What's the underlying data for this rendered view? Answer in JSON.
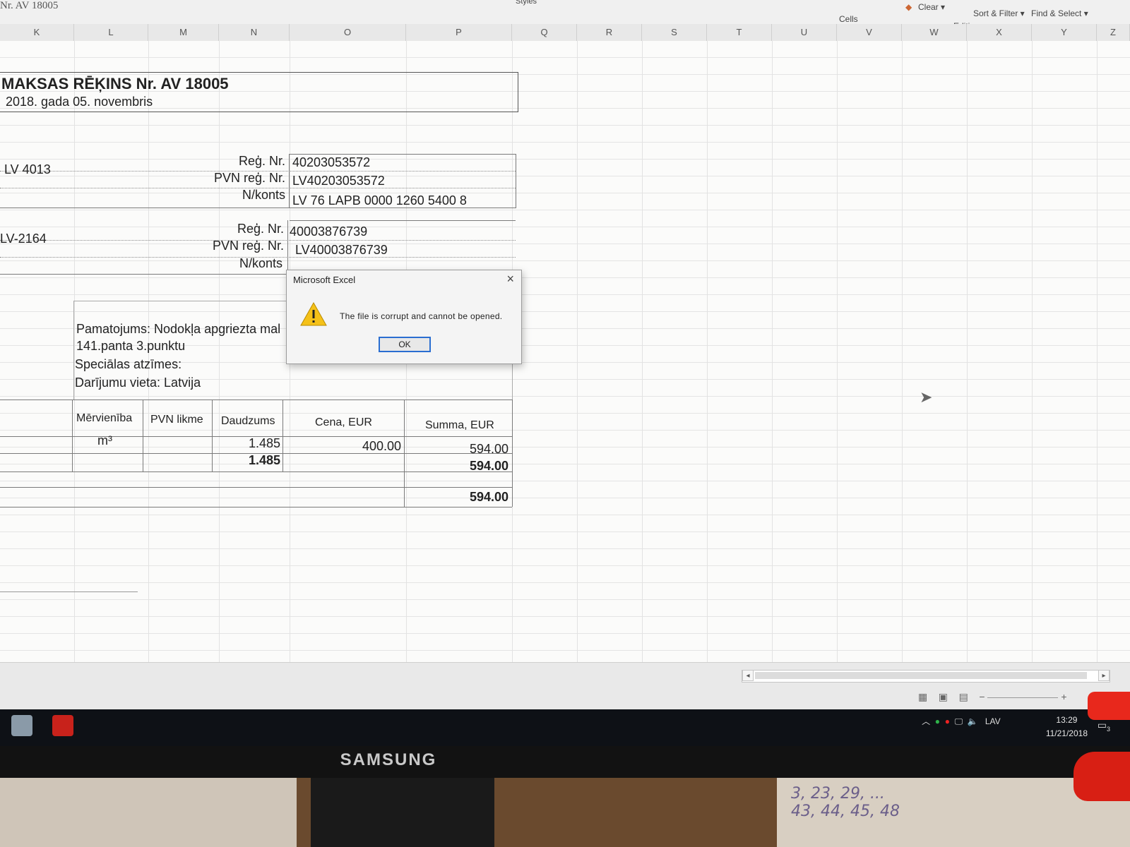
{
  "excel": {
    "namebox": "Nr. AV 18005",
    "ribbon": {
      "styles_label": "Styles",
      "cells_label": "Cells",
      "clear_label": "Clear ▾",
      "sort_filter_label": "Sort & Filter ▾",
      "find_select_label": "Find & Select ▾",
      "editing_label": "Editing"
    },
    "columns": [
      "K",
      "L",
      "M",
      "N",
      "O",
      "P",
      "Q",
      "R",
      "S",
      "T",
      "U",
      "V",
      "W",
      "X",
      "Y",
      "Z"
    ],
    "invoice": {
      "title": "MAKSAS RĒĶINS Nr. AV 18005",
      "date": "2018. gada  05. novembris",
      "seller": {
        "address_tail": "LV 4013",
        "reg_label": "Reģ. Nr.",
        "reg_value": "40203053572",
        "vat_label": "PVN reģ. Nr.",
        "vat_value": "LV40203053572",
        "acct_label": "N/konts",
        "acct_value": "LV 76 LAPB 0000 1260 5400 8"
      },
      "buyer": {
        "address_tail": "LV-2164",
        "reg_label": "Reģ. Nr.",
        "reg_value": "40003876739",
        "vat_label": "PVN reģ. Nr.",
        "vat_value": "LV40003876739",
        "acct_label": "N/konts"
      },
      "basis_line1": "Pamatojums: Nodokļa apgriezta mal",
      "basis_line2": "141.panta 3.punktu",
      "special_notes": "Speciālas atzīmes:",
      "place": "Darījumu vieta: Latvija",
      "table": {
        "headers": [
          "Mērvienība",
          "PVN likme",
          "Daudzums",
          "Cena, EUR",
          "Summa, EUR"
        ],
        "row": {
          "unit": "m³",
          "vat": "",
          "qty": "1.485",
          "price": "400.00",
          "sum": "594.00"
        },
        "subtotal": {
          "qty": "1.485",
          "sum": "594.00"
        },
        "total": "594.00"
      }
    },
    "dialog": {
      "title": "Microsoft Excel",
      "message": "The file is corrupt and cannot be opened.",
      "ok_label": "OK",
      "close_label": "×",
      "icon": "warning-icon"
    }
  },
  "taskbar": {
    "language": "LAV",
    "time": "13:29",
    "date": "11/21/2018",
    "notification_count": "3"
  },
  "monitor": {
    "brand": "SAMSUNG"
  },
  "desk_note": "3, 23, 29, ...\n43, 44, 45, 48"
}
